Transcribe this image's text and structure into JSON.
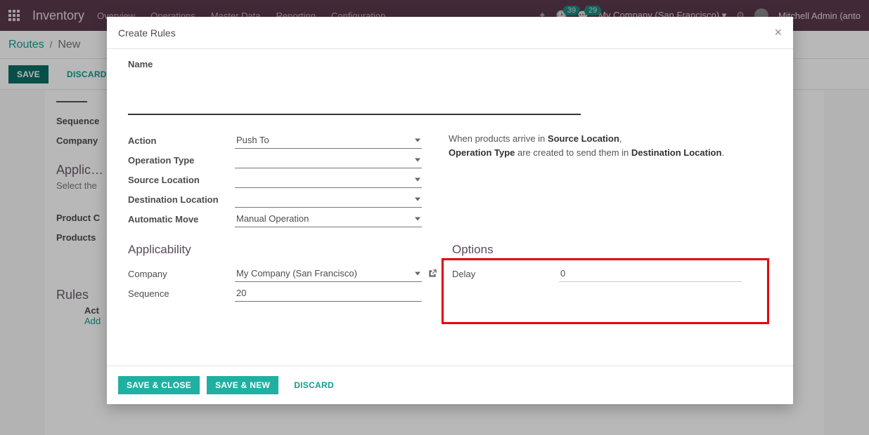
{
  "topnav": {
    "brand": "Inventory",
    "menu": [
      "Overview",
      "Operations",
      "Master Data",
      "Reporting",
      "Configuration"
    ],
    "badge1": "39",
    "badge2": "29",
    "company": "My Company (San Francisco) ▾",
    "user": "Mitchell Admin (anto"
  },
  "breadcrumb": {
    "root": "Routes",
    "current": "New"
  },
  "actions": {
    "save": "SAVE",
    "discard": "DISCARD"
  },
  "background": {
    "sequence_label": "Sequence",
    "company_label": "Company",
    "applic_title": "Applic…",
    "applic_sub": "Select the",
    "prodcat_label": "Product C",
    "products_label": "Products",
    "rules_title": "Rules",
    "act_col": "Act",
    "add_line": "Add"
  },
  "modal": {
    "title": "Create Rules",
    "name_label": "Name",
    "name_value": "",
    "fields": {
      "action_label": "Action",
      "action_value": "Push To",
      "optype_label": "Operation Type",
      "optype_value": "",
      "srcloc_label": "Source Location",
      "srcloc_value": "",
      "dstloc_label": "Destination Location",
      "dstloc_value": "",
      "automove_label": "Automatic Move",
      "automove_value": "Manual Operation"
    },
    "help": {
      "pre": "When products arrive in ",
      "b1": "Source Location",
      "mid1": ", ",
      "b2": "Operation Type",
      "mid2": " are created to send them in ",
      "b3": "Destination Location",
      "end": "."
    },
    "applicability": {
      "title": "Applicability",
      "company_label": "Company",
      "company_value": "My Company (San Francisco)",
      "sequence_label": "Sequence",
      "sequence_value": "20"
    },
    "options": {
      "title": "Options",
      "delay_label": "Delay",
      "delay_value": "0"
    },
    "footer": {
      "save_close": "SAVE & CLOSE",
      "save_new": "SAVE & NEW",
      "discard": "DISCARD"
    }
  }
}
